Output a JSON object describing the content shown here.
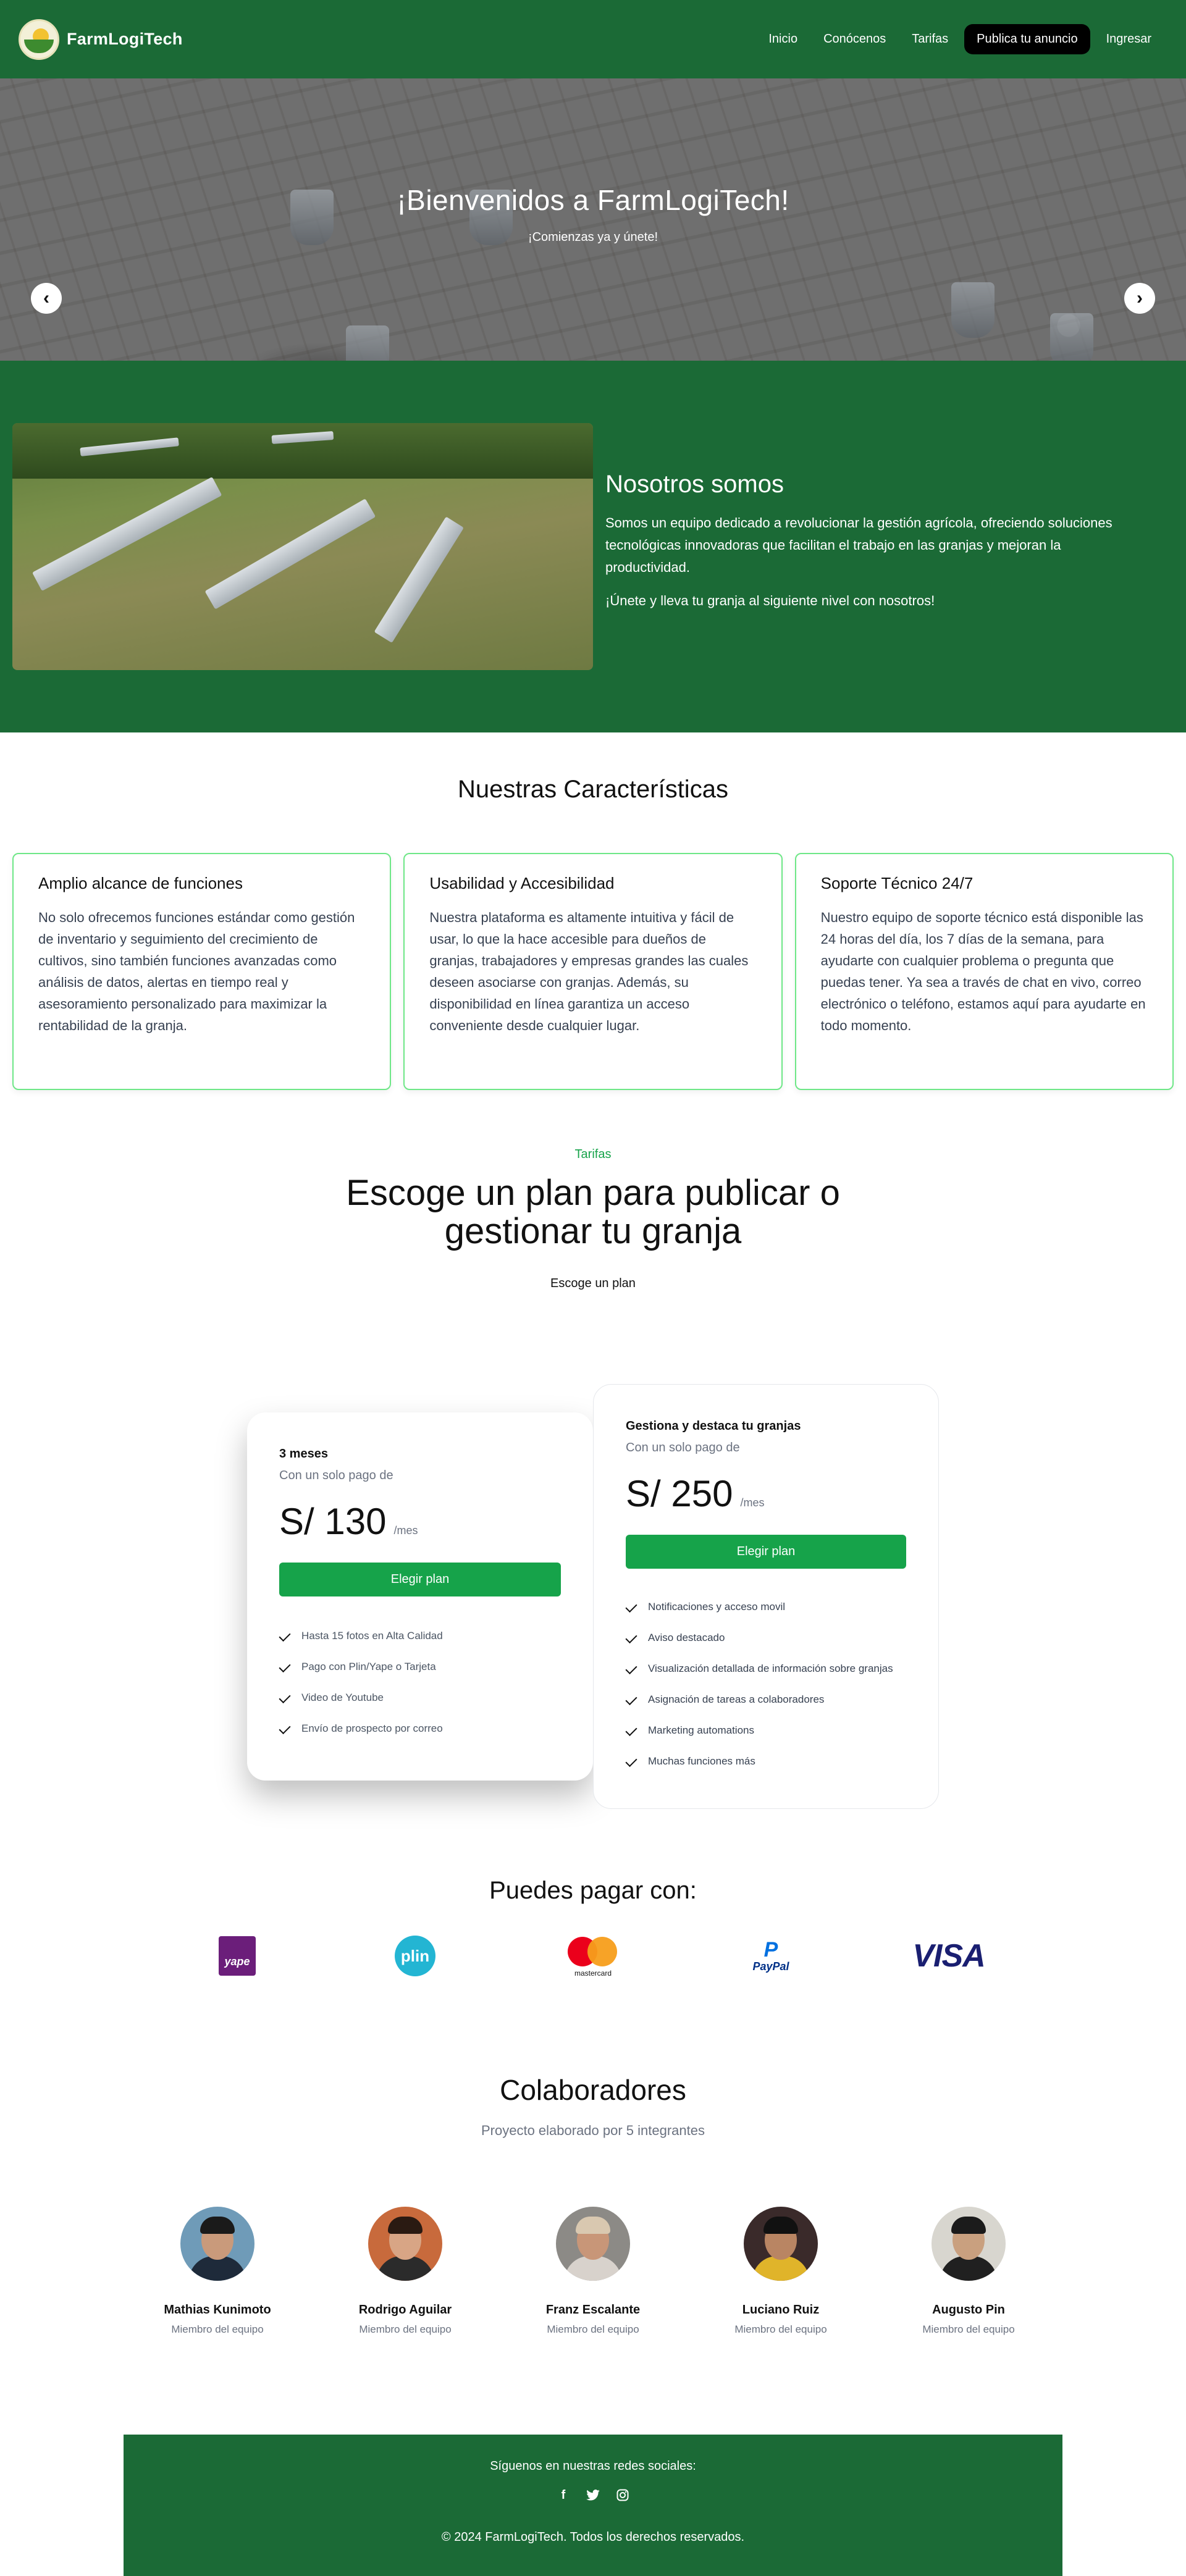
{
  "nav": {
    "brand": "FarmLogiTech",
    "links": [
      "Inicio",
      "Conócenos",
      "Tarifas"
    ],
    "cta": "Publica tu anuncio",
    "login": "Ingresar"
  },
  "hero": {
    "title": "¡Bienvenidos a FarmLogiTech!",
    "subtitle": "¡Comienzas ya y únete!",
    "prev_icon": "‹",
    "next_icon": "›"
  },
  "about": {
    "title": "Nosotros somos",
    "p1": "Somos un equipo dedicado a revolucionar la gestión agrícola, ofreciendo soluciones tecnológicas innovadoras que facilitan el trabajo en las granjas y mejoran la productividad.",
    "p2": "¡Únete y lleva tu granja al siguiente nivel con nosotros!"
  },
  "features": {
    "title": "Nuestras Características",
    "cards": [
      {
        "title": "Amplio alcance de funciones",
        "body": "No solo ofrecemos funciones estándar como gestión de inventario y seguimiento del crecimiento de cultivos, sino también funciones avanzadas como análisis de datos, alertas en tiempo real y asesoramiento personalizado para maximizar la rentabilidad de la granja."
      },
      {
        "title": "Usabilidad y Accesibilidad",
        "body": "Nuestra plataforma es altamente intuitiva y fácil de usar, lo que la hace accesible para dueños de granjas, trabajadores y empresas grandes las cuales deseen asociarse con granjas. Además, su disponibilidad en línea garantiza un acceso conveniente desde cualquier lugar."
      },
      {
        "title": "Soporte Técnico 24/7",
        "body": "Nuestro equipo de soporte técnico está disponible las 24 horas del día, los 7 días de la semana, para ayudarte con cualquier problema o pregunta que puedas tener. Ya sea a través de chat en vivo, correo electrónico o teléfono, estamos aquí para ayudarte en todo momento."
      }
    ]
  },
  "pricing": {
    "eyebrow": "Tarifas",
    "title": "Escoge un plan para publicar o gestionar tu granja",
    "subtitle": "Escoge un plan",
    "plans": [
      {
        "name": "3 meses",
        "pre": "Con un solo pago de",
        "amount": "S/ 130",
        "unit": "/mes",
        "button": "Elegir plan",
        "features": [
          "Hasta 15 fotos en Alta Calidad",
          "Pago con Plin/Yape o Tarjeta",
          "Video de Youtube",
          "Envío de prospecto por correo"
        ]
      },
      {
        "name": "Gestiona y destaca tu granjas",
        "pre": "Con un solo pago de",
        "amount": "S/ 250",
        "unit": "/mes",
        "button": "Elegir plan",
        "features": [
          "Notificaciones y acceso movil",
          "Aviso destacado",
          "Visualización detallada de información sobre granjas",
          "Asignación de tareas a colaboradores",
          "Marketing automations",
          "Muchas funciones más"
        ]
      }
    ]
  },
  "payments": {
    "title": "Puedes pagar con:",
    "yape": "yape",
    "plin": "plin",
    "mastercard": "mastercard",
    "paypal": "PayPal",
    "paypal_mark": "P",
    "visa": "VISA"
  },
  "team": {
    "title": "Colaboradores",
    "subtitle": "Proyecto elaborado por 5 integrantes",
    "members": [
      {
        "name": "Mathias Kunimoto",
        "role": "Miembro del equipo"
      },
      {
        "name": "Rodrigo Aguilar",
        "role": "Miembro del equipo"
      },
      {
        "name": "Franz Escalante",
        "role": "Miembro del equipo"
      },
      {
        "name": "Luciano Ruiz",
        "role": "Miembro del equipo"
      },
      {
        "name": "Augusto Pin",
        "role": "Miembro del equipo"
      }
    ]
  },
  "footer": {
    "follow": "Síguenos en nuestras redes sociales:",
    "facebook_icon": "f",
    "twitter_icon": "🐦",
    "instagram_icon": "◎",
    "copyright": "© 2024 FarmLogiTech. Todos los derechos reservados."
  },
  "colors": {
    "brand_green": "#1b6a36",
    "button_green": "#16a34a",
    "accent_green_border": "#6ee787"
  }
}
